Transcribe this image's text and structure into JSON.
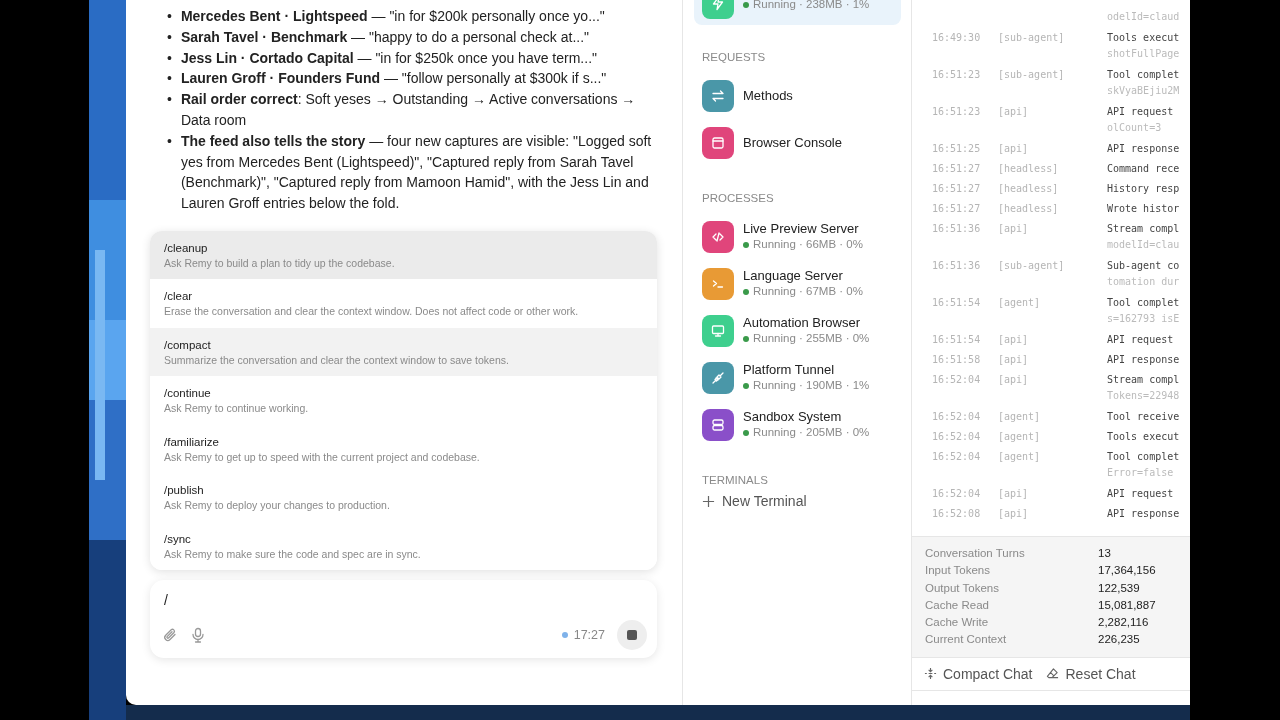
{
  "chat": {
    "bullets": [
      {
        "marker": "•",
        "text": "**Mercedes Bent · Lightspeed** — \"in for $200k personally once yo...\""
      },
      {
        "marker": "•",
        "text": "**Sarah Tavel · Benchmark** — \"happy to do a personal check at...\""
      },
      {
        "marker": "•",
        "text": "**Jess Lin · Cortado Capital** — \"in for $250k once you have term...\""
      },
      {
        "marker": "•",
        "text": "**Lauren Groff · Founders Fund** — \"follow personally at $300k if s...\""
      },
      {
        "marker": "•",
        "text": "**Rail order correct**: Soft yeses → Outstanding → Active conversations → Data room"
      },
      {
        "marker": "•",
        "text": "**The feed also tells the story** — four new captures are visible: \"Logged soft yes from Mercedes Bent (Lightspeed)\", \"Captured reply from Sarah Tavel (Benchmark)\", \"Captured reply from Mamoon Hamid\", with the Jess Lin and Lauren Groff entries below the fold."
      }
    ],
    "commands": [
      {
        "name": "/cleanup",
        "description": "Ask Remy to build a plan to tidy up the codebase.",
        "selected": true,
        "hovered": false
      },
      {
        "name": "/clear",
        "description": "Erase the conversation and clear the context window. Does not affect code or other work.",
        "selected": false,
        "hovered": false
      },
      {
        "name": "/compact",
        "description": "Summarize the conversation and clear the context window to save tokens.",
        "selected": false,
        "hovered": true
      },
      {
        "name": "/continue",
        "description": "Ask Remy to continue working.",
        "selected": false,
        "hovered": false
      },
      {
        "name": "/familiarize",
        "description": "Ask Remy to get up to speed with the current project and codebase.",
        "selected": false,
        "hovered": false
      },
      {
        "name": "/publish",
        "description": "Ask Remy to deploy your changes to production.",
        "selected": false,
        "hovered": false
      },
      {
        "name": "/sync",
        "description": "Ask Remy to make sure the code and spec are in sync.",
        "selected": false,
        "hovered": false
      }
    ],
    "input": {
      "value": "/",
      "time": "17:27"
    }
  },
  "sidebar": {
    "pinned": {
      "meta": "Running · 238MB · 1%",
      "color": "#3ecf8e",
      "kind": "bolt",
      "selected": true
    },
    "sections": [
      {
        "title": "REQUESTS",
        "items": [
          {
            "name": "Methods",
            "color": "#4a97a8",
            "kind": "arrows"
          },
          {
            "name": "Browser Console",
            "color": "#e0457b",
            "kind": "window"
          }
        ]
      },
      {
        "title": "PROCESSES",
        "items": [
          {
            "name": "Live Preview Server",
            "meta": "Running · 66MB · 0%",
            "color": "#e0457b",
            "kind": "code"
          },
          {
            "name": "Language Server",
            "meta": "Running · 67MB · 0%",
            "color": "#e89a35",
            "kind": "terminal"
          },
          {
            "name": "Automation Browser",
            "meta": "Running · 255MB · 0%",
            "color": "#3ecf8e",
            "kind": "monitor"
          },
          {
            "name": "Platform Tunnel",
            "meta": "Running · 190MB · 1%",
            "color": "#4a97a8",
            "kind": "plug"
          },
          {
            "name": "Sandbox System",
            "meta": "Running · 205MB · 0%",
            "color": "#8a4fc9",
            "kind": "server"
          }
        ]
      },
      {
        "title": "TERMINALS"
      }
    ],
    "new_terminal": "New Terminal"
  },
  "log": [
    {
      "detail": "odelId=claud"
    },
    {
      "time": "16:49:30",
      "tag": "[sub-agent]",
      "message": "Tools execut",
      "detail": "shotFullPage"
    },
    {
      "time": "16:51:23",
      "tag": "[sub-agent]",
      "message": "Tool complet",
      "detail": "skVyaBEjiu2M"
    },
    {
      "time": "16:51:23",
      "tag": "[api]",
      "message": "API request",
      "detail": "olCount=3"
    },
    {
      "time": "16:51:25",
      "tag": "[api]",
      "message": "API response"
    },
    {
      "time": "16:51:27",
      "tag": "[headless]",
      "message": "Command rece"
    },
    {
      "time": "16:51:27",
      "tag": "[headless]",
      "message": "History resp"
    },
    {
      "time": "16:51:27",
      "tag": "[headless]",
      "message": "Wrote histor"
    },
    {
      "time": "16:51:36",
      "tag": "[api]",
      "message": "Stream compl",
      "detail": "modelId=clau"
    },
    {
      "time": "16:51:36",
      "tag": "[sub-agent]",
      "message": "Sub-agent co",
      "detail": "tomation dur"
    },
    {
      "time": "16:51:54",
      "tag": "[agent]",
      "message": "Tool complet",
      "detail": "s=162793 isE"
    },
    {
      "time": "16:51:54",
      "tag": "[api]",
      "message": "API request"
    },
    {
      "time": "16:51:58",
      "tag": "[api]",
      "message": "API response"
    },
    {
      "time": "16:52:04",
      "tag": "[api]",
      "message": "Stream compl",
      "detail": "Tokens=22948"
    },
    {
      "time": "16:52:04",
      "tag": "[agent]",
      "message": "Tool receive"
    },
    {
      "time": "16:52:04",
      "tag": "[agent]",
      "message": "Tools execut"
    },
    {
      "time": "16:52:04",
      "tag": "[agent]",
      "message": "Tool complet",
      "detail": "Error=false"
    },
    {
      "time": "16:52:04",
      "tag": "[api]",
      "message": "API request"
    },
    {
      "time": "16:52:08",
      "tag": "[api]",
      "message": "API response"
    }
  ],
  "stats": [
    {
      "label": "Conversation Turns",
      "value": "13"
    },
    {
      "label": "Input Tokens",
      "value": "17,364,156"
    },
    {
      "label": "Output Tokens",
      "value": "122,539"
    },
    {
      "label": "Cache Read",
      "value": "15,081,887"
    },
    {
      "label": "Cache Write",
      "value": "2,282,116"
    },
    {
      "label": "Current Context",
      "value": "226,235"
    }
  ],
  "actions": [
    {
      "label": "Compact Chat",
      "kind": "compact"
    },
    {
      "label": "Reset Chat",
      "kind": "reset"
    }
  ]
}
